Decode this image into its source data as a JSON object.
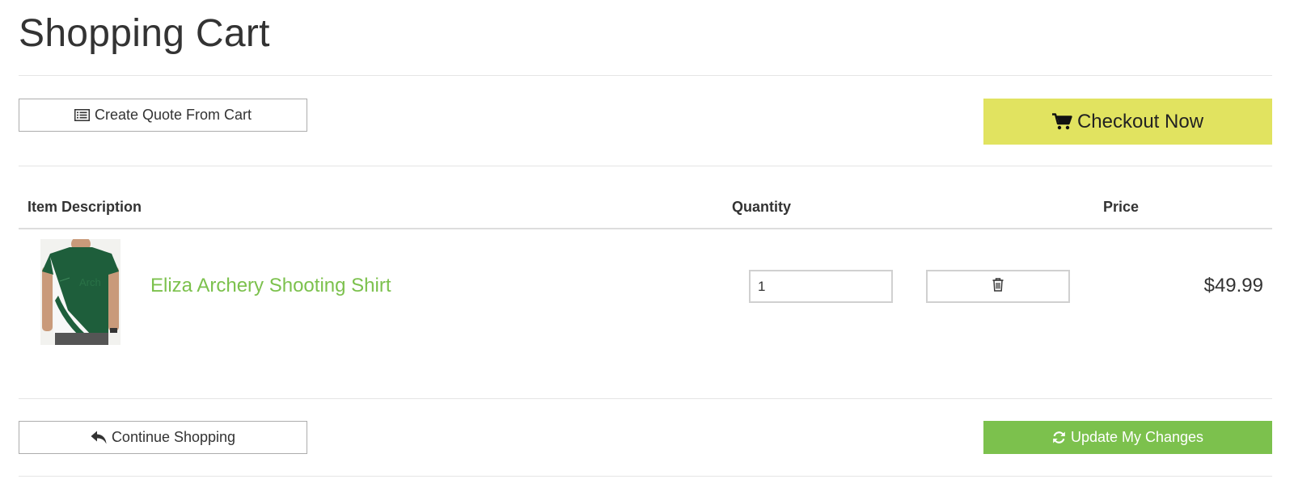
{
  "page": {
    "title": "Shopping Cart"
  },
  "toolbar_top": {
    "quote_label": "Create Quote From Cart",
    "quote_icon": "list-alt-icon",
    "checkout_label": "Checkout Now",
    "checkout_icon": "cart-icon"
  },
  "table": {
    "headers": [
      "Item Description",
      "Quantity",
      "Price"
    ],
    "rows": [
      {
        "name": "Eliza Archery Shooting Shirt",
        "quantity": "1",
        "price": "$49.99",
        "delete_icon": "trash-icon"
      }
    ]
  },
  "toolbar_bottom": {
    "continue_label": "Continue Shopping",
    "continue_icon": "reply-arrow-icon",
    "update_label": "Update My Changes",
    "update_icon": "refresh-icon"
  },
  "colors": {
    "checkout": "#e1e360",
    "update": "#7cc14d",
    "link": "#7cc14d",
    "text": "#333333"
  }
}
